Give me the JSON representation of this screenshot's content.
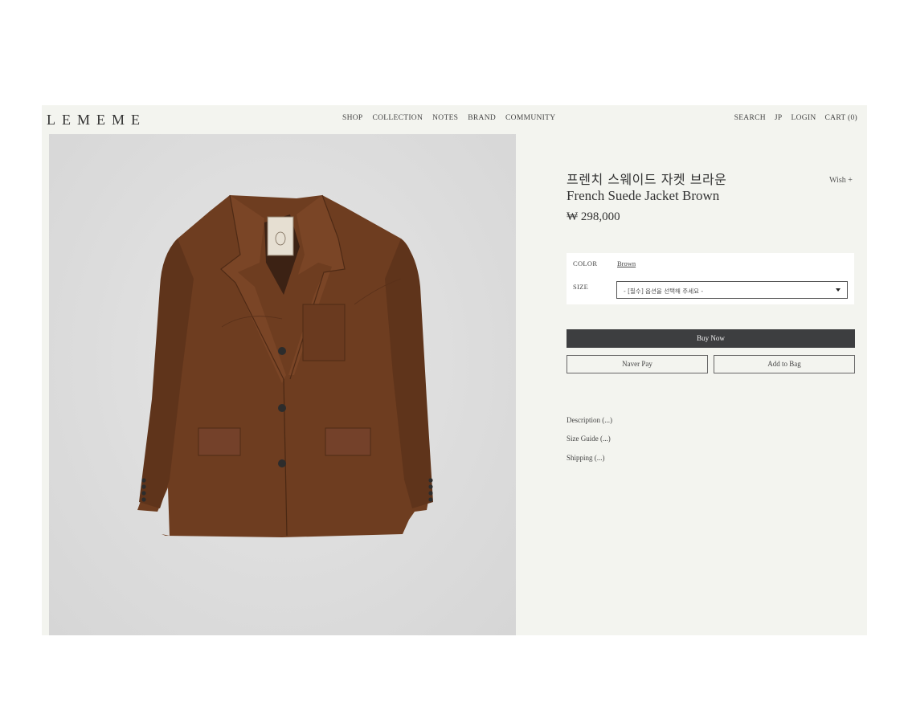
{
  "header": {
    "logo": "LEMEME",
    "nav": [
      "SHOP",
      "COLLECTION",
      "NOTES",
      "BRAND",
      "COMMUNITY"
    ],
    "utility": [
      "SEARCH",
      "JP",
      "LOGIN",
      "CART (0)"
    ]
  },
  "product": {
    "title_ko": "프렌치 스웨이드 자켓 브라운",
    "title_en": "French Suede Jacket Brown",
    "price": "₩ 298,000",
    "wish_label": "Wish +",
    "jacket_color": "#6b3a1f"
  },
  "options": {
    "color_label": "COLOR",
    "color_value": "Brown",
    "size_label": "SIZE",
    "size_placeholder": "- [필수] 옵션을 선택해 주세요 -"
  },
  "actions": {
    "buy_now": "Buy Now",
    "naver_pay": "Naver Pay",
    "add_to_bag": "Add to Bag"
  },
  "info_links": [
    "Description (...)",
    "Size Guide (...)",
    "Shipping (...)"
  ]
}
